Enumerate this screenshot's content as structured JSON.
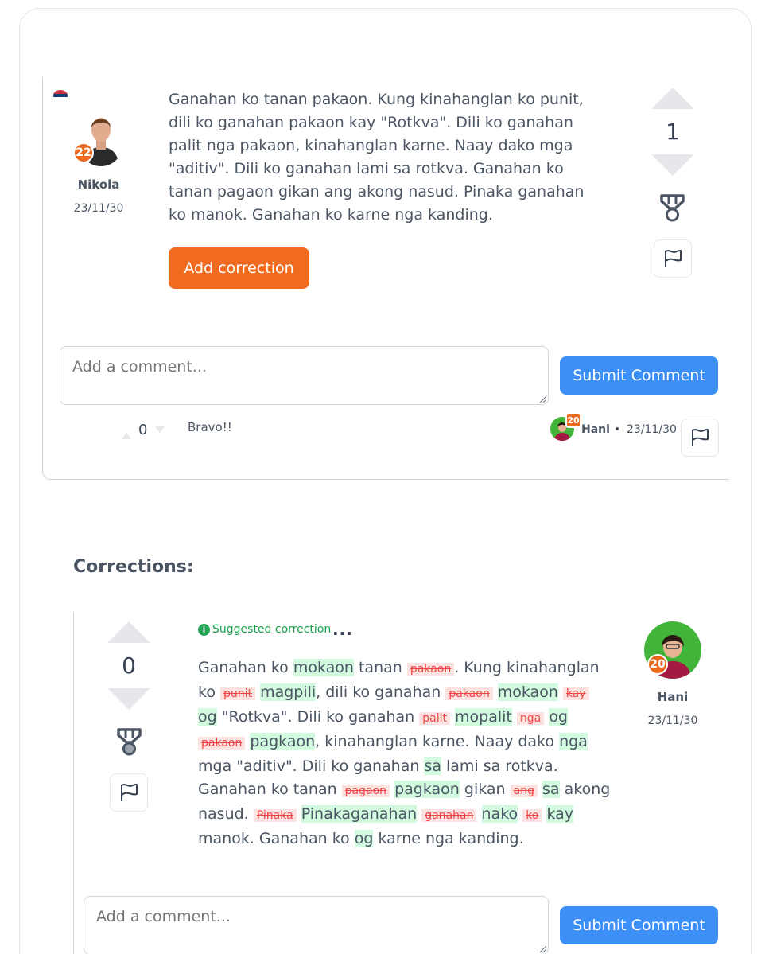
{
  "post": {
    "author": {
      "name": "Nikola",
      "date": "23/11/30",
      "level": "22",
      "country_flag": "serbia-flag-icon"
    },
    "text": "Ganahan ko tanan pakaon. Kung kinahanglan ko punit, dili ko ganahan pakaon kay \"Rotkva\". Dili ko ganahan palit nga pakaon, kinahanglan karne. Naay dako mga \"aditiv\". Dili ko ganahan lami sa rotkva. Ganahan ko tanan pagaon gikan ang akong nasud. Pinaka ganahan ko manok. Ganahan ko karne nga kanding.",
    "add_correction_label": "Add correction",
    "votes": "1"
  },
  "comment_form": {
    "placeholder": "Add a comment...",
    "submit_label": "Submit Comment"
  },
  "comment": {
    "votes": "0",
    "text": "Bravo!!",
    "author": "Hani",
    "level": "20",
    "separator": "•",
    "date": "23/11/30"
  },
  "corrections": {
    "heading": "Corrections:",
    "items": [
      {
        "votes": "0",
        "label": "Suggested correction",
        "info_icon": "i",
        "more_label": "...",
        "author": {
          "name": "Hani",
          "date": "23/11/30",
          "level": "20"
        },
        "segments": [
          {
            "t": "Ganahan ko ",
            "k": "same"
          },
          {
            "t": "mokaon",
            "k": "ins"
          },
          {
            "t": " tanan ",
            "k": "same"
          },
          {
            "t": "pakaon",
            "k": "del"
          },
          {
            "t": ". Kung kinahanglan ko ",
            "k": "same"
          },
          {
            "t": "punit",
            "k": "del"
          },
          {
            "t": " ",
            "k": "same"
          },
          {
            "t": "magpili",
            "k": "ins"
          },
          {
            "t": ", dili ko ganahan ",
            "k": "same"
          },
          {
            "t": "pakaon",
            "k": "del"
          },
          {
            "t": " ",
            "k": "same"
          },
          {
            "t": "mokaon",
            "k": "ins"
          },
          {
            "t": " ",
            "k": "same"
          },
          {
            "t": "kay",
            "k": "del"
          },
          {
            "t": " ",
            "k": "same"
          },
          {
            "t": "og",
            "k": "ins"
          },
          {
            "t": " \"Rotkva\". Dili ko ganahan ",
            "k": "same"
          },
          {
            "t": "palit",
            "k": "del"
          },
          {
            "t": " ",
            "k": "same"
          },
          {
            "t": "mopalit",
            "k": "ins"
          },
          {
            "t": " ",
            "k": "same"
          },
          {
            "t": "nga",
            "k": "del"
          },
          {
            "t": " ",
            "k": "same"
          },
          {
            "t": "og",
            "k": "ins"
          },
          {
            "t": " ",
            "k": "same"
          },
          {
            "t": "pakaon",
            "k": "del"
          },
          {
            "t": " ",
            "k": "same"
          },
          {
            "t": "pagkaon",
            "k": "ins"
          },
          {
            "t": ", kinahanglan karne. Naay dako ",
            "k": "same"
          },
          {
            "t": "nga",
            "k": "ins"
          },
          {
            "t": " mga \"aditiv\". Dili ko ganahan ",
            "k": "same"
          },
          {
            "t": "sa",
            "k": "ins"
          },
          {
            "t": " lami sa rotkva. Ganahan ko tanan ",
            "k": "same"
          },
          {
            "t": "pagaon",
            "k": "del"
          },
          {
            "t": " ",
            "k": "same"
          },
          {
            "t": "pagkaon",
            "k": "ins"
          },
          {
            "t": " gikan ",
            "k": "same"
          },
          {
            "t": "ang",
            "k": "del"
          },
          {
            "t": " ",
            "k": "same"
          },
          {
            "t": "sa",
            "k": "ins"
          },
          {
            "t": " akong nasud. ",
            "k": "same"
          },
          {
            "t": "Pinaka",
            "k": "del"
          },
          {
            "t": " ",
            "k": "same"
          },
          {
            "t": "Pinakaganahan",
            "k": "ins"
          },
          {
            "t": " ",
            "k": "same"
          },
          {
            "t": "ganahan",
            "k": "del"
          },
          {
            "t": " ",
            "k": "same"
          },
          {
            "t": "nako",
            "k": "ins"
          },
          {
            "t": " ",
            "k": "same"
          },
          {
            "t": "ko",
            "k": "del"
          },
          {
            "t": " ",
            "k": "same"
          },
          {
            "t": "kay",
            "k": "ins"
          },
          {
            "t": " manok. Ganahan ko ",
            "k": "same"
          },
          {
            "t": "og",
            "k": "ins"
          },
          {
            "t": " karne nga kanding.",
            "k": "same"
          }
        ]
      }
    ]
  },
  "colors": {
    "accent_orange": "#f06b1f",
    "submit_blue": "#3b8ff7",
    "insert_bg": "#d1fadf",
    "delete_bg": "#fde2e2",
    "delete_text": "#ef4444",
    "suggested_green": "#16a34a"
  }
}
